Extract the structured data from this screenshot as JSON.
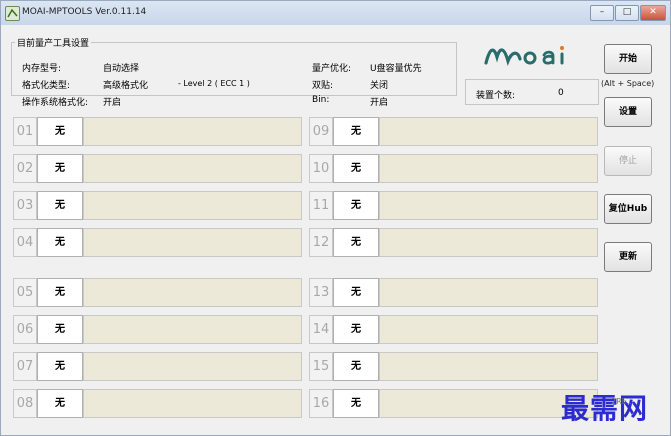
{
  "window": {
    "title": "MOAI-MPTOOLS Ver.0.11.14",
    "buttons": [
      "–",
      "□",
      "✕"
    ]
  },
  "settings": {
    "legend": "目前量产工具设置",
    "rows": [
      {
        "label": "内存型号:",
        "value": "自动选择"
      },
      {
        "label": "格式化类型:",
        "value": "高级格式化",
        "extra": "- Level 2 ( ECC 1 )"
      },
      {
        "label": "操作系统格式化:",
        "value": "开启"
      }
    ],
    "right_rows": [
      {
        "label": "量产优化:",
        "value": "U盘容量优先"
      },
      {
        "label": "双贴:",
        "value": "关闭"
      },
      {
        "label": "Bin:",
        "value": "开启"
      }
    ]
  },
  "logo": {
    "text": "moai",
    "color": "#2a6c6a"
  },
  "device_count": {
    "label": "装置个数:",
    "value": "0"
  },
  "actions": {
    "start": "开始",
    "start_hint": "(Alt + Space)",
    "settings": "设置",
    "stop": "停止",
    "reset_hub": "复位Hub",
    "update": "更新"
  },
  "ports": [
    {
      "num": "01",
      "status": "无"
    },
    {
      "num": "02",
      "status": "无"
    },
    {
      "num": "03",
      "status": "无"
    },
    {
      "num": "04",
      "status": "无"
    },
    {
      "num": "05",
      "status": "无"
    },
    {
      "num": "06",
      "status": "无"
    },
    {
      "num": "07",
      "status": "无"
    },
    {
      "num": "08",
      "status": "无"
    },
    {
      "num": "09",
      "status": "无"
    },
    {
      "num": "10",
      "status": "无"
    },
    {
      "num": "11",
      "status": "无"
    },
    {
      "num": "12",
      "status": "无"
    },
    {
      "num": "13",
      "status": "无"
    },
    {
      "num": "14",
      "status": "无"
    },
    {
      "num": "15",
      "status": "无"
    },
    {
      "num": "16",
      "status": "无"
    }
  ],
  "watermark": {
    "text": "最需网",
    "small": "2RE..."
  }
}
